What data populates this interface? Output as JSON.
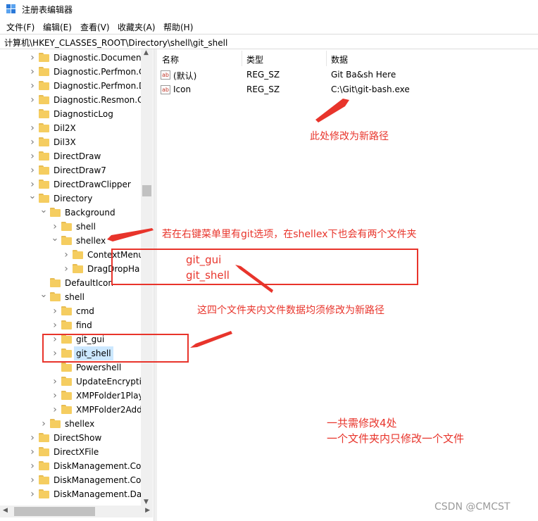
{
  "window": {
    "title": "注册表编辑器"
  },
  "menu": [
    "文件(F)",
    "编辑(E)",
    "查看(V)",
    "收藏夹(A)",
    "帮助(H)"
  ],
  "address": "计算机\\HKEY_CLASSES_ROOT\\Directory\\shell\\git_shell",
  "tree": [
    {
      "label": "Diagnostic.Document",
      "level": 0,
      "expander": "collapsed"
    },
    {
      "label": "Diagnostic.Perfmon.C",
      "level": 0,
      "expander": "collapsed"
    },
    {
      "label": "Diagnostic.Perfmon.D",
      "level": 0,
      "expander": "collapsed"
    },
    {
      "label": "Diagnostic.Resmon.C",
      "level": 0,
      "expander": "collapsed"
    },
    {
      "label": "DiagnosticLog",
      "level": 0,
      "expander": "none"
    },
    {
      "label": "Dil2X",
      "level": 0,
      "expander": "collapsed"
    },
    {
      "label": "Dil3X",
      "level": 0,
      "expander": "collapsed"
    },
    {
      "label": "DirectDraw",
      "level": 0,
      "expander": "collapsed"
    },
    {
      "label": "DirectDraw7",
      "level": 0,
      "expander": "collapsed"
    },
    {
      "label": "DirectDrawClipper",
      "level": 0,
      "expander": "collapsed"
    },
    {
      "label": "Directory",
      "level": 0,
      "expander": "expanded"
    },
    {
      "label": "Background",
      "level": 1,
      "expander": "expanded"
    },
    {
      "label": "shell",
      "level": 2,
      "expander": "collapsed"
    },
    {
      "label": "shellex",
      "level": 2,
      "expander": "expanded"
    },
    {
      "label": "ContextMenu",
      "level": 3,
      "expander": "collapsed"
    },
    {
      "label": "DragDropHa",
      "level": 3,
      "expander": "collapsed"
    },
    {
      "label": "DefaultIcon",
      "level": 1,
      "expander": "none"
    },
    {
      "label": "shell",
      "level": 1,
      "expander": "expanded"
    },
    {
      "label": "cmd",
      "level": 2,
      "expander": "collapsed"
    },
    {
      "label": "find",
      "level": 2,
      "expander": "collapsed"
    },
    {
      "label": "git_gui",
      "level": 2,
      "expander": "collapsed"
    },
    {
      "label": "git_shell",
      "level": 2,
      "expander": "collapsed",
      "selected": true
    },
    {
      "label": "Powershell",
      "level": 2,
      "expander": "none"
    },
    {
      "label": "UpdateEncryptic",
      "level": 2,
      "expander": "collapsed"
    },
    {
      "label": "XMPFolder1Play",
      "level": 2,
      "expander": "collapsed"
    },
    {
      "label": "XMPFolder2Add",
      "level": 2,
      "expander": "collapsed"
    },
    {
      "label": "shellex",
      "level": 1,
      "expander": "collapsed"
    },
    {
      "label": "DirectShow",
      "level": 0,
      "expander": "collapsed"
    },
    {
      "label": "DirectXFile",
      "level": 0,
      "expander": "collapsed"
    },
    {
      "label": "DiskManagement.Cor",
      "level": 0,
      "expander": "collapsed"
    },
    {
      "label": "DiskManagement.Cor",
      "level": 0,
      "expander": "collapsed"
    },
    {
      "label": "DiskManagement.Dat",
      "level": 0,
      "expander": "collapsed"
    }
  ],
  "columns": [
    "名称",
    "类型",
    "数据"
  ],
  "values": [
    {
      "name": "(默认)",
      "type": "REG_SZ",
      "data": "Git Ba&sh Here",
      "icon": "string-value-icon"
    },
    {
      "name": "Icon",
      "type": "REG_SZ",
      "data": "C:\\Git\\git-bash.exe",
      "icon": "string-value-icon"
    }
  ],
  "annotations": {
    "modify_path": "此处修改为新路径",
    "shellex_note": "若在右键菜单里有git选项，在shellex下也会有两个文件夹",
    "box_line1": "git_gui",
    "box_line2": "git_shell",
    "four_folders": "这四个文件夹内文件数据均须修改为新路径",
    "summary_line1": "一共需修改4处",
    "summary_line2": "一个文件夹内只修改一个文件"
  },
  "watermark": "CSDN @CMCST",
  "colors": {
    "annotation": "#e8342b",
    "folder": "#f5cd60",
    "selection": "#cce8ff"
  }
}
